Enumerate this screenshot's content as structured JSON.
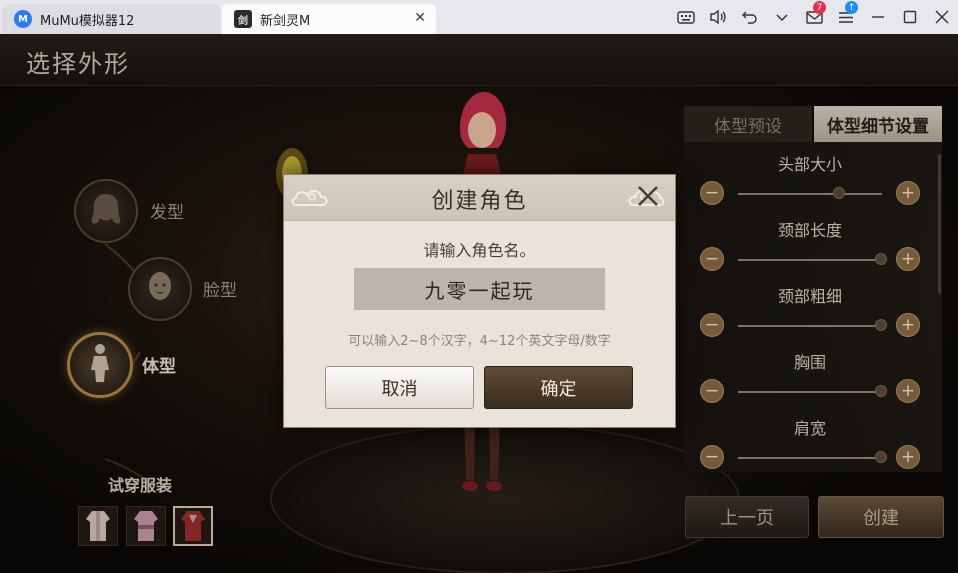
{
  "window": {
    "tabs": [
      {
        "label": "MuMu模拟器12",
        "icon": "mumu-logo-icon"
      },
      {
        "label": "新剑灵M",
        "icon": "game-app-icon"
      }
    ],
    "toolbar_icons": [
      "keyboard-icon",
      "volume-icon",
      "undo-icon",
      "chevron-down-icon",
      "mail-icon",
      "menu-icon",
      "minimize-icon",
      "maximize-icon",
      "close-icon"
    ],
    "mail_badge": "7",
    "menu_badge": "↑"
  },
  "page": {
    "title": "选择外形"
  },
  "left_menu": {
    "items": [
      {
        "label": "发型",
        "icon": "hair-icon"
      },
      {
        "label": "脸型",
        "icon": "face-icon"
      },
      {
        "label": "体型",
        "icon": "body-icon",
        "active": true
      }
    ],
    "outfit_title": "试穿服装",
    "outfits": [
      "outfit-1",
      "outfit-2",
      "outfit-3"
    ],
    "selected_outfit": 2
  },
  "right_panel": {
    "tabs": [
      "体型预设",
      "体型细节设置"
    ],
    "active_tab": 1,
    "sliders": [
      {
        "label": "头部大小",
        "value": 0.7
      },
      {
        "label": "颈部长度",
        "value": 0.99
      },
      {
        "label": "颈部粗细",
        "value": 0.99
      },
      {
        "label": "胸围",
        "value": 0.99
      },
      {
        "label": "肩宽",
        "value": 0.99
      }
    ],
    "minus": "−",
    "plus": "+",
    "prev_label": "上一页",
    "create_label": "创建"
  },
  "dialog": {
    "title": "创建角色",
    "close": "✕",
    "prompt": "请输入角色名。",
    "name_value": "九零一起玩",
    "hint": "可以输入2~8个汉字，4~12个英文字母/数字",
    "cancel_label": "取消",
    "ok_label": "确定"
  },
  "colors": {
    "accent_gold": "#b58a4a",
    "dialog_bg": "#e9e3da",
    "ok_button": "#4a3b2a"
  }
}
